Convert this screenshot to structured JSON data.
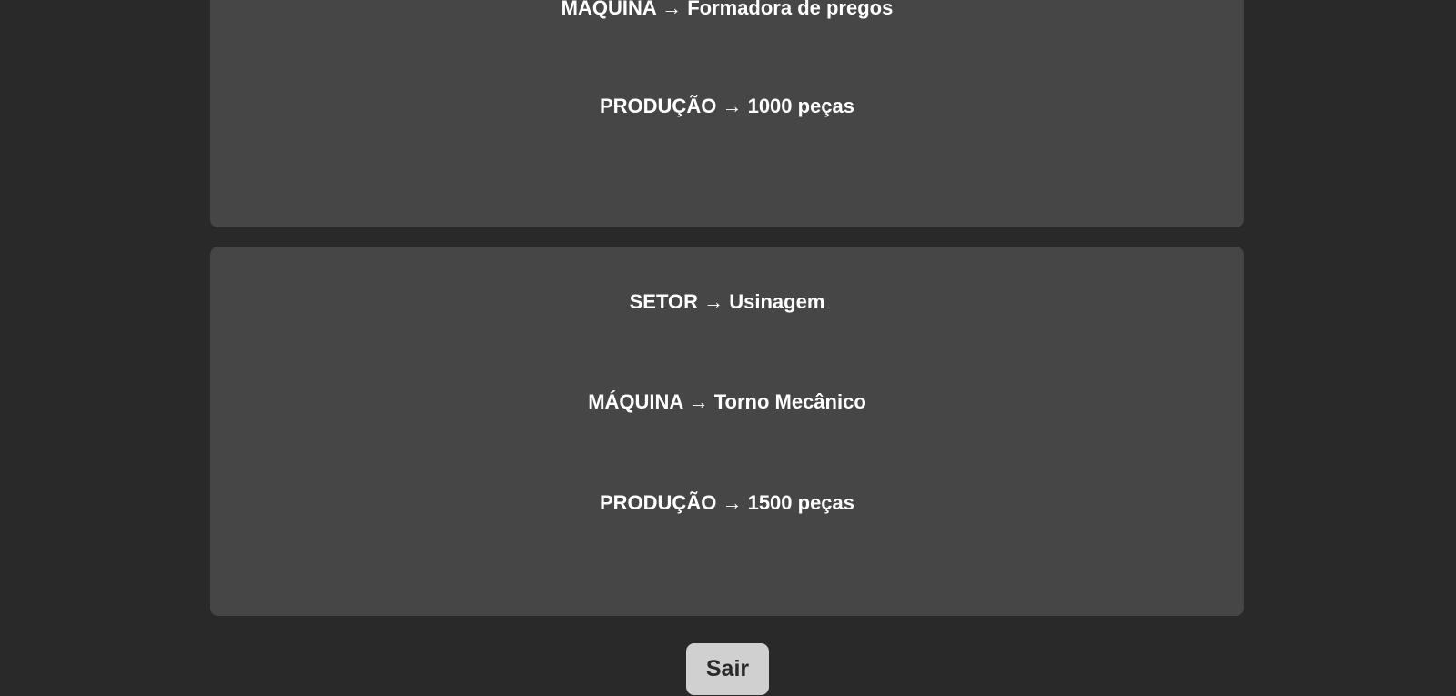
{
  "records": [
    {
      "machine_label": "MÁQUINA",
      "machine_value": "Formadora de pregos",
      "production_label": "PRODUÇÃO",
      "production_value": "1000 peças"
    },
    {
      "sector_label": "SETOR",
      "sector_value": "Usinagem",
      "machine_label": "MÁQUINA",
      "machine_value": "Torno Mecânico",
      "production_label": "PRODUÇÃO",
      "production_value": "1500 peças"
    }
  ],
  "arrow": "→",
  "exit_button_label": "Sair",
  "colors": {
    "background": "#292929",
    "card": "#464646",
    "text": "#ffffff",
    "button": "#d0d0d0",
    "button_text": "#2a2a2a"
  }
}
